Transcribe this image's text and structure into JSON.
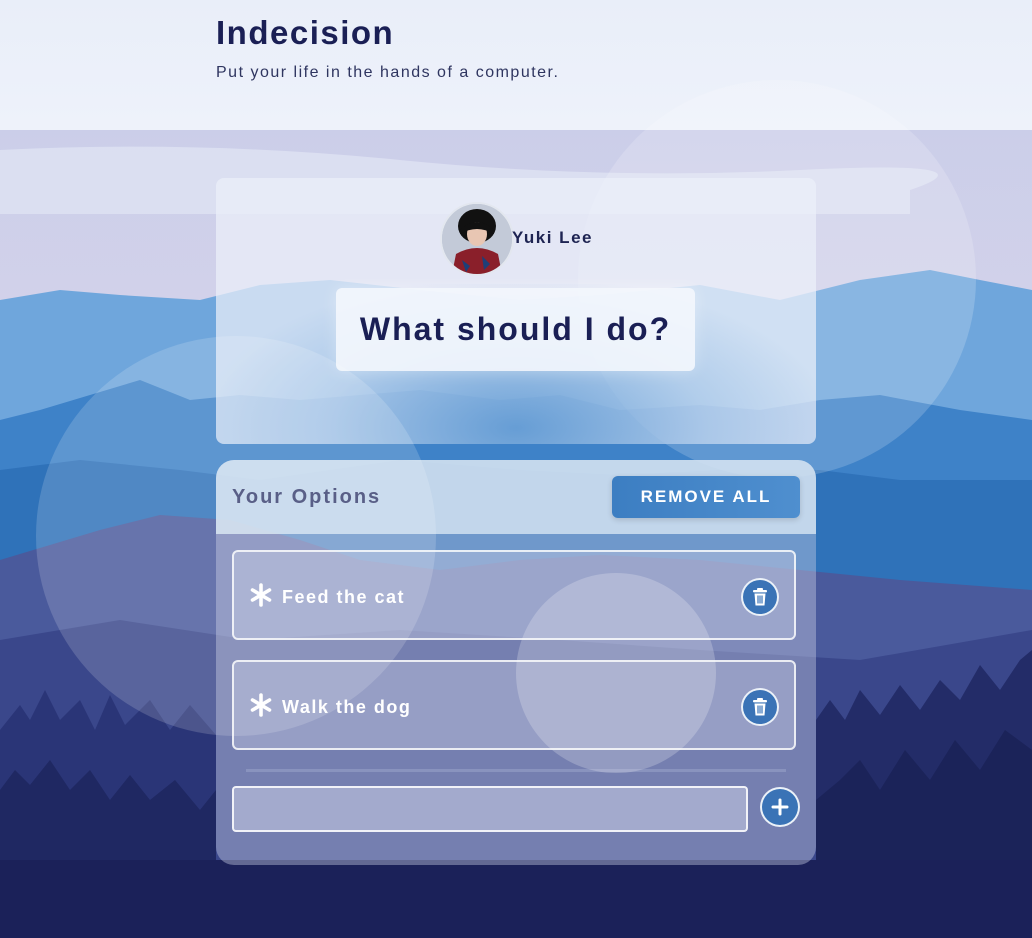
{
  "app": {
    "title": "Indecision",
    "subtitle": "Put your life in the hands of a computer."
  },
  "user": {
    "name": "Yuki Lee"
  },
  "decide_button": {
    "label": "What should I do?"
  },
  "options_panel": {
    "title": "Your Options",
    "remove_all_label": "REMOVE ALL",
    "items": [
      {
        "text": "Feed the cat"
      },
      {
        "text": "Walk the dog"
      }
    ],
    "add_input": {
      "value": "",
      "placeholder": ""
    }
  },
  "colors": {
    "accent": "#3c7ec2",
    "title_text": "#1a1f55",
    "header_bg": "#e9eef9"
  },
  "icons": {
    "option_marker": "asterisk-icon",
    "delete": "trash-icon",
    "add": "plus-icon"
  }
}
